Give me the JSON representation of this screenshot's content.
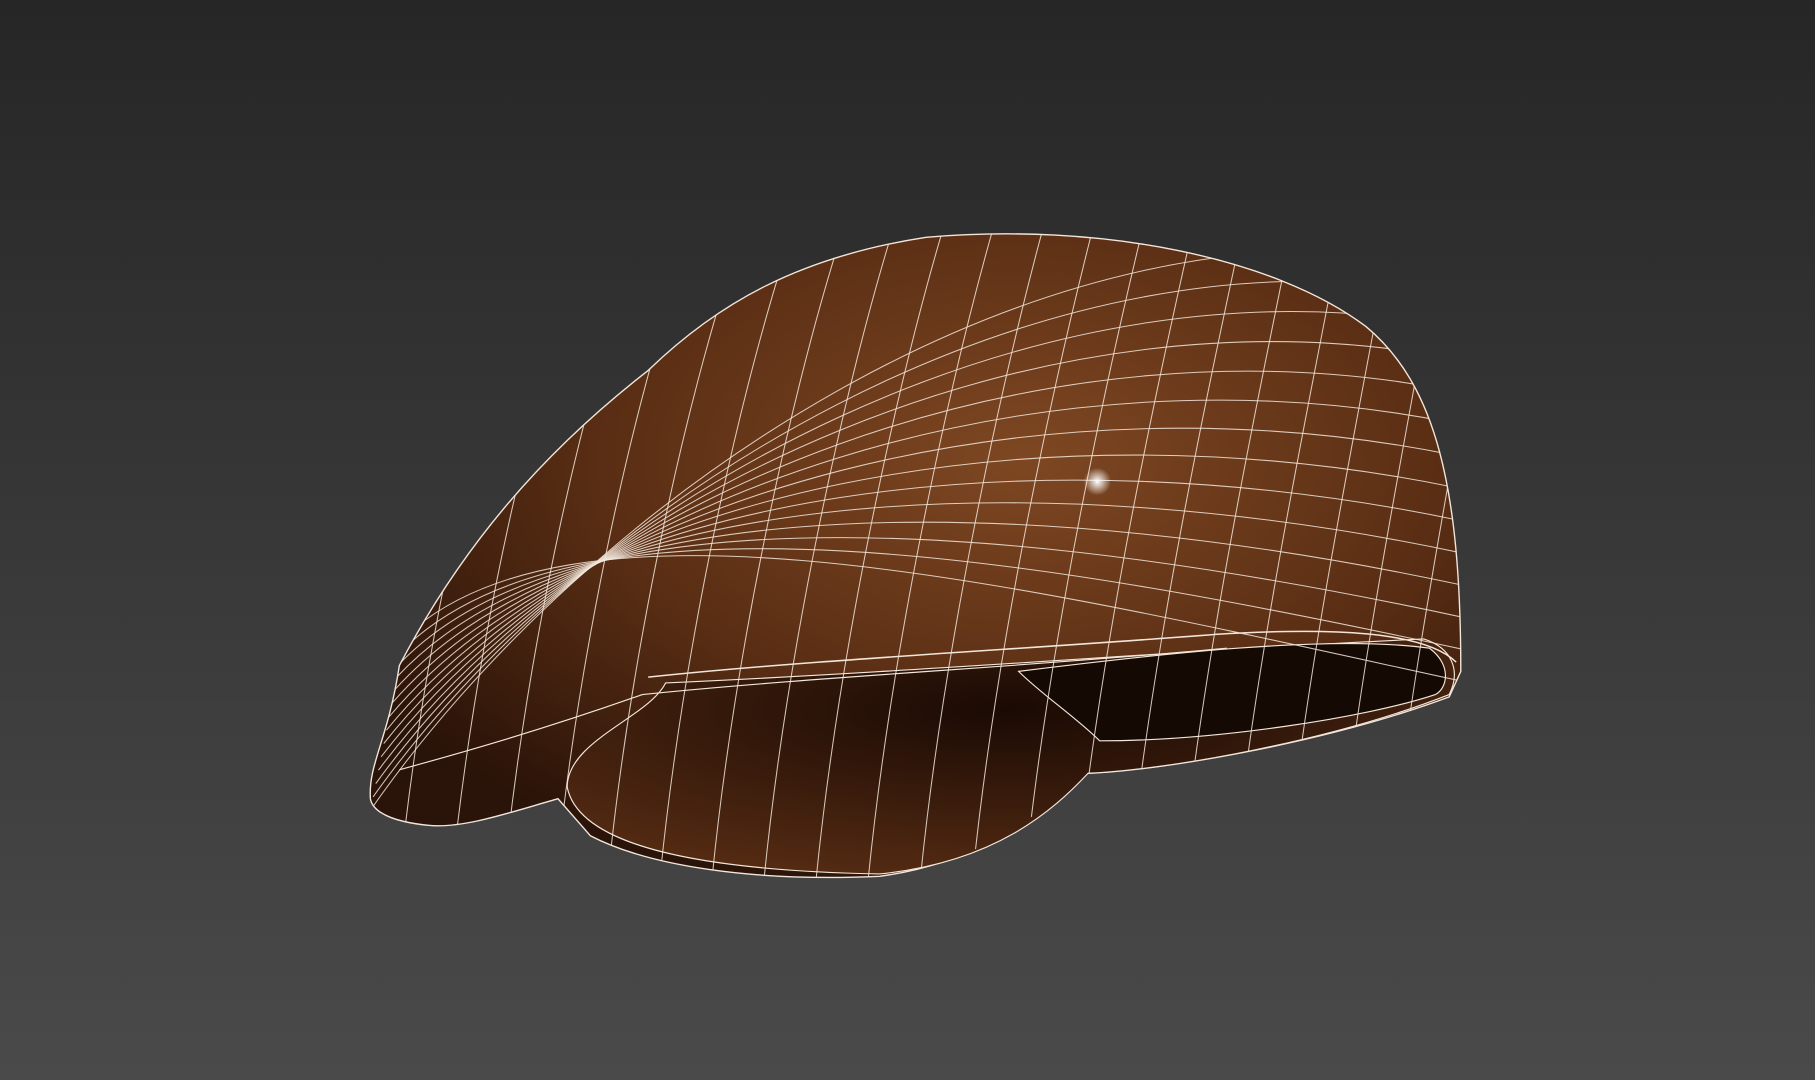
{
  "viewport": {
    "background_top": "#262626",
    "background_bottom": "#4a4a4a"
  },
  "model": {
    "cap_color_light": "#7e4722",
    "cap_color_dark": "#2a1308",
    "inner_color": "#150904",
    "wire_color": "#f2e6da",
    "highlight_color": "#ffffff"
  }
}
